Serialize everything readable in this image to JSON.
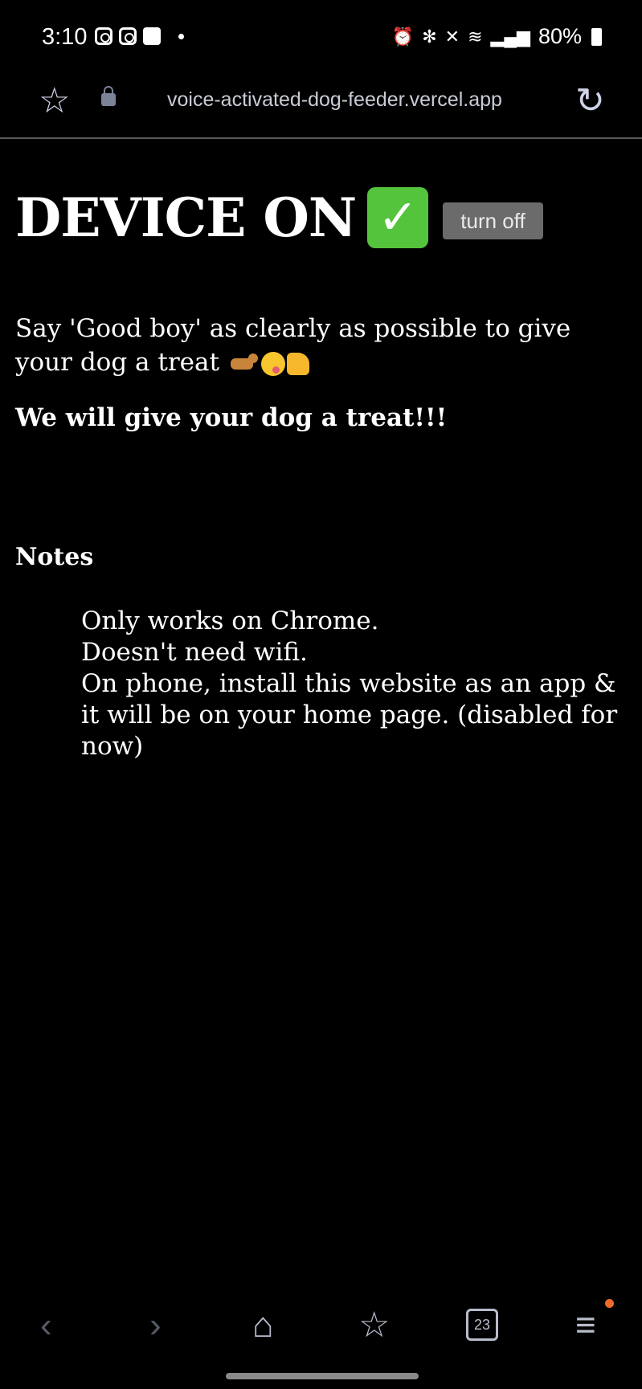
{
  "status_bar": {
    "time": "3:10",
    "battery": "80%"
  },
  "browser": {
    "url": "voice-activated-dog-feeder.vercel.app",
    "tab_count": "23"
  },
  "page": {
    "headline": "DEVICE ON",
    "turn_off_label": "turn off",
    "instruction": "Say 'Good boy' as clearly as possible to give your dog a treat",
    "treat_message": "We will give your dog a treat!!!",
    "notes_heading": "Notes",
    "notes": [
      "Only works on Chrome.",
      "Doesn't need wifi.",
      "On phone, install this website as an app & it will be on your home page. (disabled for now)"
    ]
  },
  "icons": {
    "headline_icon": "check-mark-icon",
    "instruction_emojis": [
      "dog-icon",
      "yum-face-icon",
      "thumbs-up-icon"
    ]
  },
  "colors": {
    "background": "#000000",
    "check_green": "#54c43c",
    "button_gray": "#6b6b6b",
    "menu_badge": "#f06a2a"
  }
}
